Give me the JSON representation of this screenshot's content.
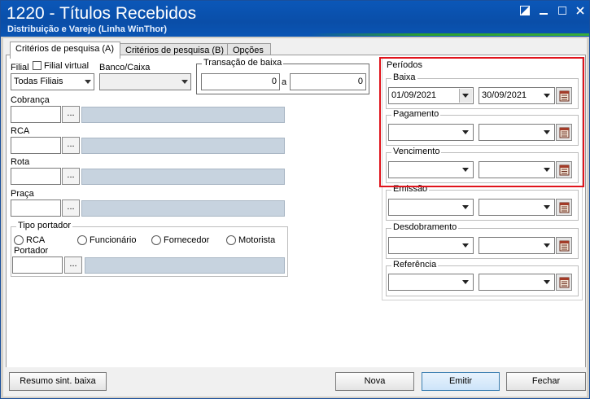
{
  "window": {
    "title": "1220 - Títulos Recebidos",
    "subtitle": "Distribuição e Varejo (Linha WinThor)"
  },
  "tabs": [
    {
      "label": "Critérios de pesquisa (A)"
    },
    {
      "label": "Critérios de pesquisa (B)"
    },
    {
      "label": "Opções"
    }
  ],
  "filters": {
    "filial_label": "Filial",
    "filial_virtual_label": "Filial virtual",
    "filial_value": "Todas Filiais",
    "banco_label": "Banco/Caixa",
    "banco_value": "",
    "transacao_label": "Transação de baixa",
    "transacao_from": "0",
    "transacao_sep": "a",
    "transacao_to": "0",
    "cobranca_label": "Cobrança",
    "rca_label": "RCA",
    "rota_label": "Rota",
    "praca_label": "Praça",
    "dots_label": "..."
  },
  "tipo_portador": {
    "title": "Tipo portador",
    "options": [
      "RCA",
      "Funcionário",
      "Fornecedor",
      "Motorista"
    ],
    "portador_label": "Portador"
  },
  "periodos": {
    "title": "Períodos",
    "baixa": {
      "label": "Baixa",
      "from": "01/09/2021",
      "to": "30/09/2021"
    },
    "pagamento": {
      "label": "Pagamento",
      "from": "",
      "to": ""
    },
    "vencimento": {
      "label": "Vencimento",
      "from": "",
      "to": ""
    },
    "emissao": {
      "label": "Emissão",
      "from": "",
      "to": ""
    },
    "desdobramento": {
      "label": "Desdobramento",
      "from": "",
      "to": ""
    },
    "referencia": {
      "label": "Referência",
      "from": "",
      "to": ""
    }
  },
  "buttons": {
    "resumo": "Resumo sint. baixa",
    "nova": "Nova",
    "emitir": "Emitir",
    "fechar": "Fechar"
  },
  "colors": {
    "title_bar": "#0a4ea8",
    "highlight": "#e0141c",
    "disabled_field": "#c7d3df"
  }
}
